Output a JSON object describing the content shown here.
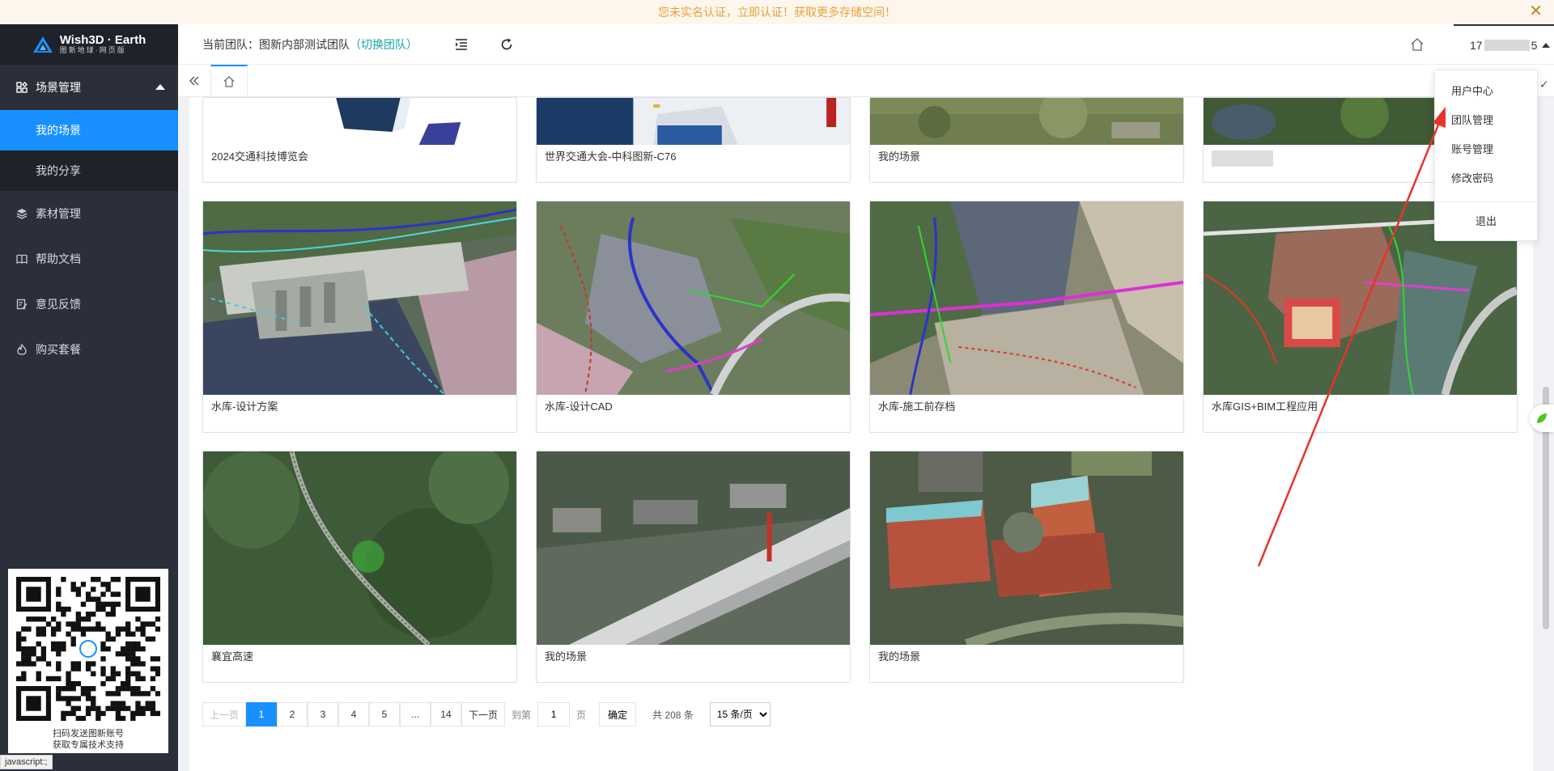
{
  "notice": {
    "prefix": "您未实名认证，",
    "link": "立即认证",
    "suffix": "！获取更多存储空间！",
    "close": "✕"
  },
  "brand": {
    "title": "Wish3D · Earth",
    "subtitle": "图新地球·网页版"
  },
  "sidebar": {
    "group": "场景管理",
    "sub_items": [
      "我的场景",
      "我的分享"
    ],
    "items": [
      "素材管理",
      "帮助文档",
      "意见反馈",
      "购买套餐"
    ],
    "qr_caption_1": "扫码发送图新账号",
    "qr_caption_2": "获取专属技术支持"
  },
  "header": {
    "team_prefix": "当前团队：",
    "team_name": "图新内部测试团队",
    "team_switch": "（切换团队）",
    "user_start": "17",
    "user_end": "5"
  },
  "dropdown": {
    "items": [
      "用户中心",
      "团队管理",
      "账号管理",
      "修改密码"
    ],
    "logout": "退出"
  },
  "cards_top": [
    "2024交通科技博览会",
    "世界交通大会-中科图新-C76",
    "我的场景"
  ],
  "cards_row2": [
    "水库-设计方案",
    "水库-设计CAD",
    "水库-施工前存档",
    "水库GIS+BIM工程应用"
  ],
  "cards_row3": [
    "襄宜高速",
    "我的场景",
    "我的场景"
  ],
  "pagination": {
    "prev": "上一页",
    "pages": [
      "1",
      "2",
      "3",
      "4",
      "5",
      "...",
      "14"
    ],
    "next": "下一页",
    "goto": "到第",
    "goto_value": "1",
    "page_unit": "页",
    "confirm": "确定",
    "total": "共 208 条",
    "page_size": "15 条/页"
  },
  "status_tip": "javascript:;",
  "colors": {
    "accent": "#1890ff",
    "sidebar": "#2b2f3a",
    "notice_text": "#e6a23c",
    "switch": "#13a8a8",
    "arrow": "#e8332a"
  }
}
